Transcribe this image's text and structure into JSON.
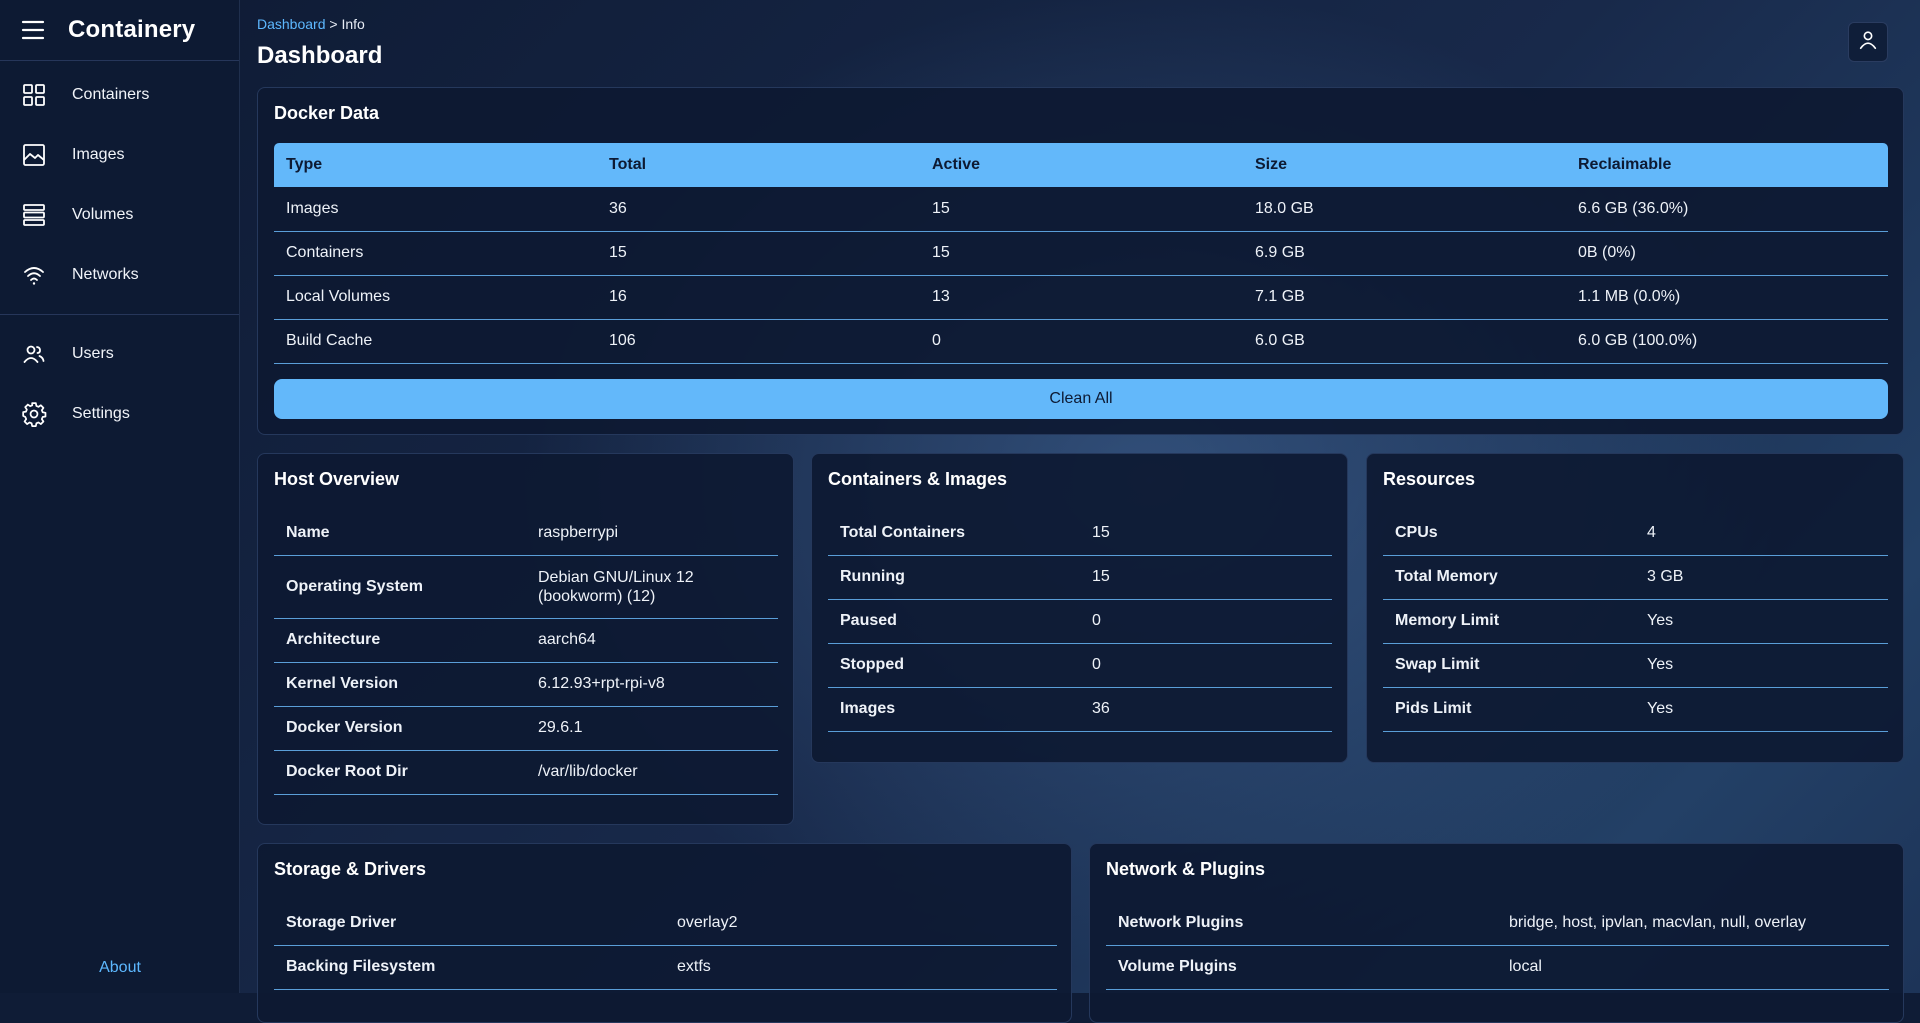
{
  "app": {
    "title": "Containery"
  },
  "sidebar": {
    "items_top": [
      {
        "label": "Containers",
        "icon": "grid-icon"
      },
      {
        "label": "Images",
        "icon": "image-icon"
      },
      {
        "label": "Volumes",
        "icon": "stack-icon"
      },
      {
        "label": "Networks",
        "icon": "wifi-icon"
      }
    ],
    "items_bottom": [
      {
        "label": "Users",
        "icon": "users-icon"
      },
      {
        "label": "Settings",
        "icon": "gear-icon"
      }
    ],
    "about_label": "About"
  },
  "breadcrumb": {
    "link": "Dashboard",
    "separator": ">",
    "current": "Info"
  },
  "page_title": "Dashboard",
  "docker_data": {
    "title": "Docker Data",
    "headers": [
      "Type",
      "Total",
      "Active",
      "Size",
      "Reclaimable"
    ],
    "rows": [
      [
        "Images",
        "36",
        "15",
        "18.0 GB",
        "6.6 GB (36.0%)"
      ],
      [
        "Containers",
        "15",
        "15",
        "6.9 GB",
        "0B (0%)"
      ],
      [
        "Local Volumes",
        "16",
        "13",
        "7.1 GB",
        "1.1 MB (0.0%)"
      ],
      [
        "Build Cache",
        "106",
        "0",
        "6.0 GB",
        "6.0 GB (100.0%)"
      ]
    ],
    "clean_button": "Clean All"
  },
  "host_overview": {
    "title": "Host Overview",
    "rows": [
      [
        "Name",
        "raspberrypi"
      ],
      [
        "Operating System",
        "Debian GNU/Linux 12 (bookworm) (12)"
      ],
      [
        "Architecture",
        "aarch64"
      ],
      [
        "Kernel Version",
        "6.12.93+rpt-rpi-v8"
      ],
      [
        "Docker Version",
        "29.6.1"
      ],
      [
        "Docker Root Dir",
        "/var/lib/docker"
      ]
    ]
  },
  "containers_images": {
    "title": "Containers & Images",
    "rows": [
      [
        "Total Containers",
        "15"
      ],
      [
        "Running",
        "15"
      ],
      [
        "Paused",
        "0"
      ],
      [
        "Stopped",
        "0"
      ],
      [
        "Images",
        "36"
      ]
    ]
  },
  "resources": {
    "title": "Resources",
    "rows": [
      [
        "CPUs",
        "4"
      ],
      [
        "Total Memory",
        "3 GB"
      ],
      [
        "Memory Limit",
        "Yes"
      ],
      [
        "Swap Limit",
        "Yes"
      ],
      [
        "Pids Limit",
        "Yes"
      ]
    ]
  },
  "storage_drivers": {
    "title": "Storage & Drivers",
    "rows": [
      [
        "Storage Driver",
        "overlay2"
      ],
      [
        "Backing Filesystem",
        "extfs"
      ]
    ]
  },
  "network_plugins": {
    "title": "Network & Plugins",
    "rows": [
      [
        "Network Plugins",
        "bridge, host, ipvlan, macvlan, null, overlay"
      ],
      [
        "Volume Plugins",
        "local"
      ]
    ]
  },
  "colors": {
    "accent": "#63b8fa",
    "link": "#5db8ff",
    "sidebar_bg": "#0d1a33",
    "card_bg": "#0d1932"
  }
}
